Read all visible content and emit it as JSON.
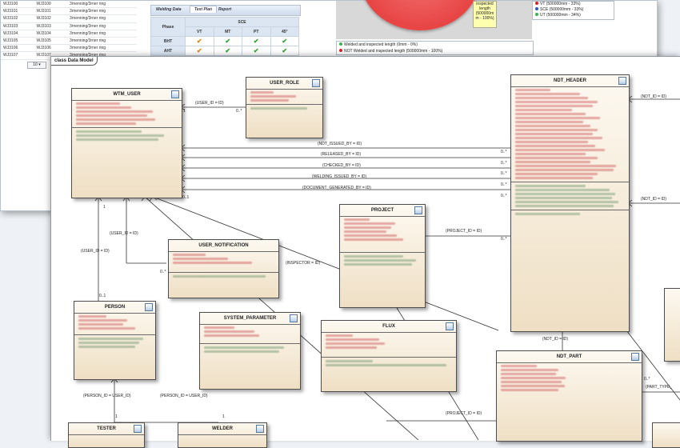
{
  "back_window": {
    "rows": [
      {
        "id": "WJ3100",
        "weld": "WJ3100",
        "procedure": "3rnenning/3rner ring"
      },
      {
        "id": "WJ3101",
        "weld": "WJ3101",
        "procedure": "3rnenning/3rner ring"
      },
      {
        "id": "WJ3102",
        "weld": "WJ3102",
        "procedure": "3rnenning/3rner ring"
      },
      {
        "id": "WJ3103",
        "weld": "WJ3103",
        "procedure": "3rnenning/3rner ring"
      },
      {
        "id": "WJ3104",
        "weld": "WJ3104",
        "procedure": "3rnenning/3rner ring"
      },
      {
        "id": "WJ3105",
        "weld": "WJ3105",
        "procedure": "3rnenning/3rner ring"
      },
      {
        "id": "WJ3106",
        "weld": "WJ3106",
        "procedure": "3rnenning/3rner ring"
      },
      {
        "id": "WJ3107",
        "weld": "WJ3107",
        "procedure": "3rnenning/3rner ring"
      }
    ],
    "pager_value": "10",
    "tabs": [
      "Welding Data",
      "Test Plan",
      "Report"
    ],
    "grid": {
      "phase_header": "Phase",
      "group_header": "SCE",
      "columns": [
        "VT",
        "MT",
        "PT",
        "45°"
      ],
      "rows": [
        {
          "phase": "BHT",
          "marks": [
            "orange",
            "green",
            "green",
            "green"
          ]
        },
        {
          "phase": "AHT",
          "marks": [
            "orange",
            "green",
            "green",
            "green"
          ]
        }
      ]
    },
    "pie_tooltip": [
      "inspected",
      "length",
      "(500000m",
      "m - 100%)"
    ],
    "legend_status": [
      {
        "color": "#39b54a",
        "text": "Welded and inspected length (0mm - 0%)"
      },
      {
        "color": "#e02020",
        "text": "NOT Welded and inspected length (500000mm - 100%)"
      }
    ],
    "legend_methods": [
      {
        "color": "#e02020",
        "text": "VT (500000mm - 33%)"
      },
      {
        "color": "#2d57c8",
        "text": "SCE (500000mm - 33%)"
      },
      {
        "color": "#39b54a",
        "text": "UT (500000mm - 34%)"
      }
    ]
  },
  "diagram": {
    "tab_label": "class Data Model",
    "classes": {
      "wtm_user": "WTM_USER",
      "user_role": "USER_ROLE",
      "ndt_header": "NDT_HEADER",
      "project": "PROJECT",
      "user_notification": "USER_NOTIFICATION",
      "person": "PERSON",
      "system_parameter": "SYSTEM_PARAMETER",
      "flux": "FLUX",
      "ndt_part": "NDT_PART",
      "tester": "TESTER",
      "welder": "WELDER"
    },
    "labels": {
      "user_id_role": "(USER_ID = ID)",
      "ndt_id_top": "(NDT_ID = ID)",
      "ndt_issued_by": "(NDT_ISSUED_BY = ID)",
      "released_by": "(RELEASED_BY = ID)",
      "checked_by": "(CHECKED_BY = ID)",
      "welding_issued_by": "(WELDING_ISSUED_BY = ID)",
      "document_generated_by": "(DOCUMENT_GENERATED_BY = ID)",
      "ndt_id_right": "(NDT_ID = ID)",
      "user_id_notif": "(USER_ID = ID)",
      "user_id_person": "(USER_ID = ID)",
      "project_id": "(PROJECT_ID = ID)",
      "inspector": "(INSPECTOR = ID)",
      "ndt_id_part": "(NDT_ID = ID)",
      "part_type": "(PART_TYPE_",
      "project_id_flux": "(PROJECT_ID = ID)",
      "person_id_tester": "(PERSON_ID = USER_ID)",
      "person_id_welder": "(PERSON_ID = USER_ID)"
    },
    "multiplicity": {
      "one": "1",
      "zero_many": "0..*",
      "zero_one": "0..1",
      "one_up": "1"
    }
  }
}
